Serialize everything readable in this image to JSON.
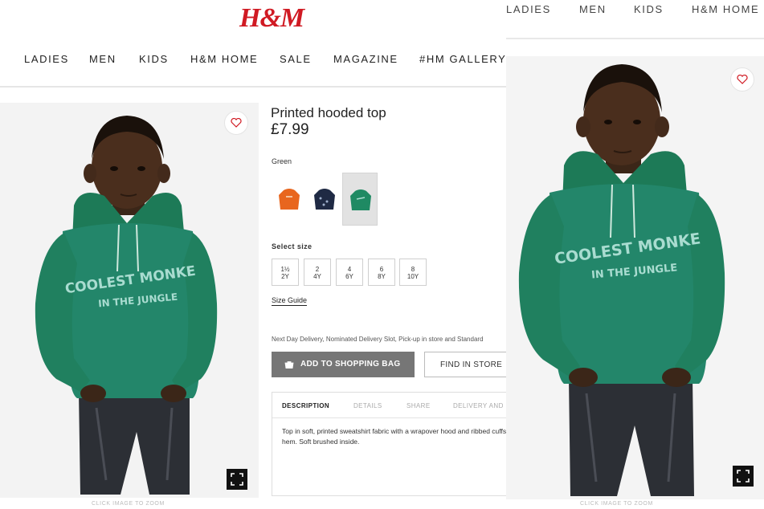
{
  "brand": {
    "logo_text": "H&M",
    "logo_color": "#d01a23"
  },
  "left_page": {
    "nav": [
      "LADIES",
      "MEN",
      "KIDS",
      "H&M HOME",
      "SALE",
      "MAGAZINE",
      "#HM GALLERY"
    ],
    "product": {
      "name": "Printed hooded top",
      "price": "£7.99",
      "color_label": "Green",
      "swatches": [
        {
          "name": "orange",
          "color": "#e8661e"
        },
        {
          "name": "navy",
          "color": "#1f2a44"
        },
        {
          "name": "green",
          "color": "#1f8a63",
          "selected": true
        }
      ],
      "select_size_label": "Select size",
      "sizes": [
        {
          "top": "1½",
          "bottom": "2Y"
        },
        {
          "top": "2",
          "bottom": "4Y"
        },
        {
          "top": "4",
          "bottom": "6Y"
        },
        {
          "top": "6",
          "bottom": "8Y"
        },
        {
          "top": "8",
          "bottom": "10Y"
        }
      ],
      "size_guide": "Size Guide",
      "delivery_text": "Next Day Delivery, Nominated Delivery Slot, Pick-up in store and Standard",
      "add_button": "ADD TO SHOPPING BAG",
      "find_button": "FIND IN STORE",
      "tabs": [
        "DESCRIPTION",
        "DETAILS",
        "SHARE",
        "DELIVERY AND PAYMENT"
      ],
      "description": "Top in soft, printed sweatshirt fabric with a wrapover hood and ribbed cuffs and hem. Soft brushed inside."
    },
    "hoodie_print": {
      "line1": "COOLEST MONKE",
      "line2": "IN THE JUNGLE"
    },
    "zoom_caption": "CLICK IMAGE TO ZOOM"
  },
  "right_page": {
    "nav": [
      "LADIES",
      "MEN",
      "KIDS",
      "H&M HOME"
    ],
    "hoodie_print": {
      "line1": "COOLEST MONKE",
      "line2": "IN THE JUNGLE"
    },
    "zoom_caption": "CLICK IMAGE TO ZOOM"
  }
}
